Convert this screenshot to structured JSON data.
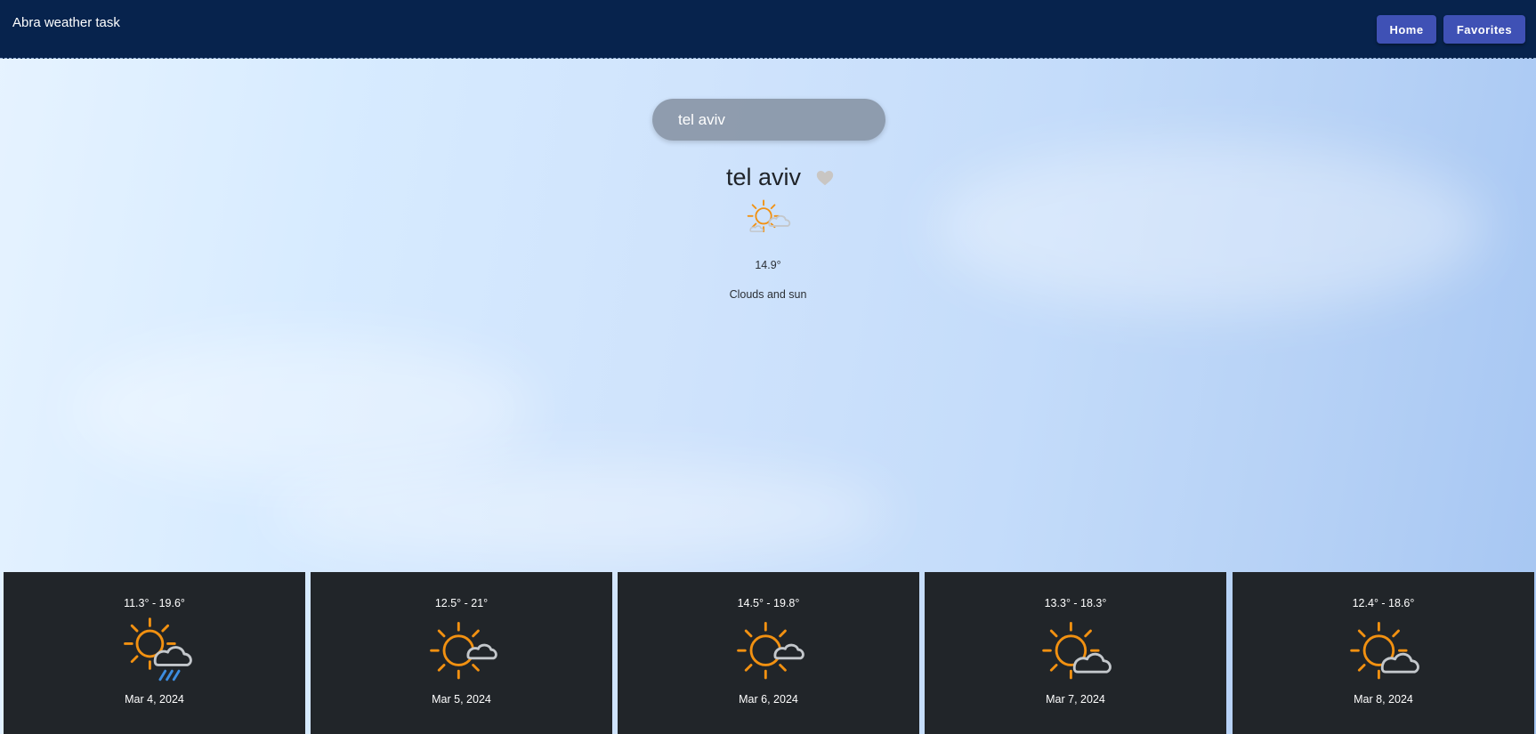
{
  "header": {
    "title": "Abra weather task",
    "home_label": "Home",
    "favorites_label": "Favorites"
  },
  "search": {
    "value": "tel aviv"
  },
  "current": {
    "city": "tel aviv",
    "temperature": "14.9°",
    "description": "Clouds and sun",
    "icon": "sun-cloud-icon",
    "favorite": false
  },
  "forecast": [
    {
      "range": "11.3° - 19.6°",
      "date": "Mar 4, 2024",
      "icon": "sun-cloud-rain-icon"
    },
    {
      "range": "12.5° - 21°",
      "date": "Mar 5, 2024",
      "icon": "sun-small-cloud-icon"
    },
    {
      "range": "14.5° - 19.8°",
      "date": "Mar 6, 2024",
      "icon": "sun-small-cloud-icon"
    },
    {
      "range": "13.3° - 18.3°",
      "date": "Mar 7, 2024",
      "icon": "sun-cloud-icon"
    },
    {
      "range": "12.4° - 18.6°",
      "date": "Mar 8, 2024",
      "icon": "sun-cloud-icon"
    }
  ],
  "colors": {
    "header_bg": "#07234d",
    "button_bg": "#3f51b5",
    "card_bg": "#212529",
    "sun": "#f29111",
    "cloud": "#c3c7cb",
    "rain": "#3d8de0",
    "heart": "#c9c6c3"
  }
}
